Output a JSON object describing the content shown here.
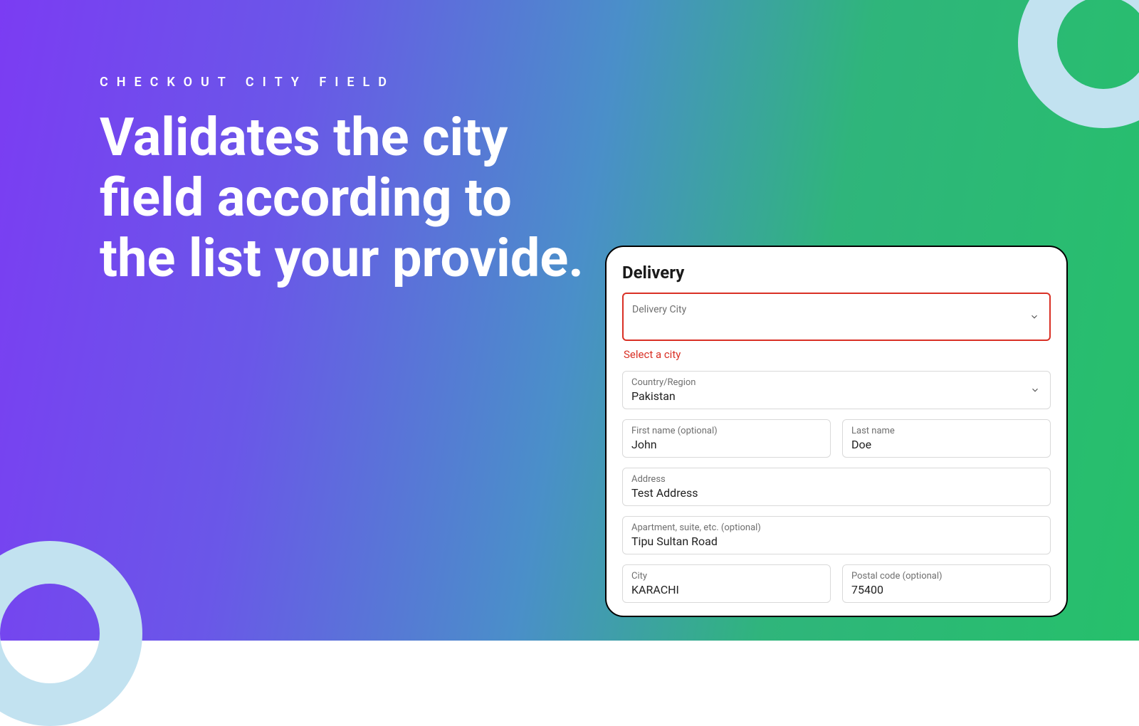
{
  "hero": {
    "eyebrow": "CHECKOUT CITY FIELD",
    "headline": "Validates the city field according to the list your provide."
  },
  "card": {
    "title": "Delivery",
    "delivery_city": {
      "label": "Delivery City",
      "value": "",
      "error": "Select a city"
    },
    "country": {
      "label": "Country/Region",
      "value": "Pakistan"
    },
    "first_name": {
      "label": "First name (optional)",
      "value": "John"
    },
    "last_name": {
      "label": "Last name",
      "value": "Doe"
    },
    "address": {
      "label": "Address",
      "value": "Test Address"
    },
    "apartment": {
      "label": "Apartment, suite, etc. (optional)",
      "value": "Tipu Sultan Road"
    },
    "city": {
      "label": "City",
      "value": "KARACHI"
    },
    "postal": {
      "label": "Postal code (optional)",
      "value": "75400"
    }
  },
  "colors": {
    "error": "#d93025",
    "ring": "#c2e2f0"
  }
}
